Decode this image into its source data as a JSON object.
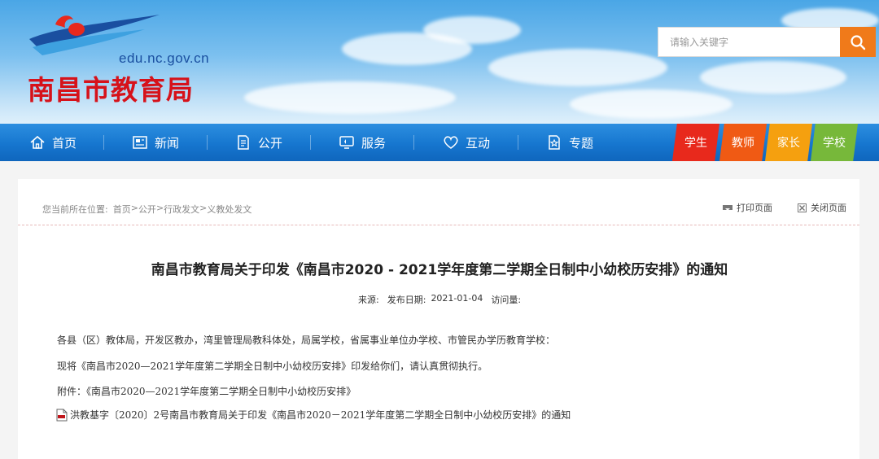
{
  "header": {
    "domain": "edu.nc.gov.cn",
    "site_name": "南昌市教育局",
    "search": {
      "placeholder": "请输入关键字"
    }
  },
  "nav": {
    "items": [
      {
        "label": "首页",
        "icon": "home-icon"
      },
      {
        "label": "新闻",
        "icon": "news-icon"
      },
      {
        "label": "公开",
        "icon": "document-icon"
      },
      {
        "label": "服务",
        "icon": "monitor-icon"
      },
      {
        "label": "互动",
        "icon": "heart-icon"
      },
      {
        "label": "专题",
        "icon": "star-doc-icon"
      }
    ],
    "roles": [
      {
        "label": "学生",
        "color": "#e8291c"
      },
      {
        "label": "教师",
        "color": "#f05a14"
      },
      {
        "label": "家长",
        "color": "#f5a00f"
      },
      {
        "label": "学校",
        "color": "#77b83a"
      }
    ]
  },
  "breadcrumb": {
    "prefix": "您当前所在位置:",
    "items": [
      "首页",
      ">",
      "公开",
      ">",
      "行政发文",
      ">",
      "义教处发文"
    ]
  },
  "toolbar": {
    "print_label": "打印页面",
    "close_label": "关闭页面"
  },
  "article": {
    "title": "南昌市教育局关于印发《南昌市2020 - 2021学年度第二学期全日制中小幼校历安排》的通知",
    "source_label": "来源:",
    "date_label": "发布日期:",
    "date": "2021-01-04",
    "views_label": "访问量:",
    "paragraphs": [
      "各县（区）教体局，开发区教办，湾里管理局教科体处，局属学校，省属事业单位办学校、市管民办学历教育学校：",
      "现将《南昌市2020—2021学年度第二学期全日制中小幼校历安排》印发给你们，请认真贯彻执行。",
      "附件：《南昌市2020—2021学年度第二学期全日制中小幼校历安排》"
    ],
    "attachment": "洪教基字〔2020〕2号南昌市教育局关于印发《南昌市2020－2021学年度第二学期全日制中小幼校历安排》的通知"
  },
  "colors": {
    "nav_blue": "#1676cf",
    "search_orange": "#f07a1a",
    "logo_red": "#d6121a",
    "logo_blue": "#1a4fa0"
  }
}
